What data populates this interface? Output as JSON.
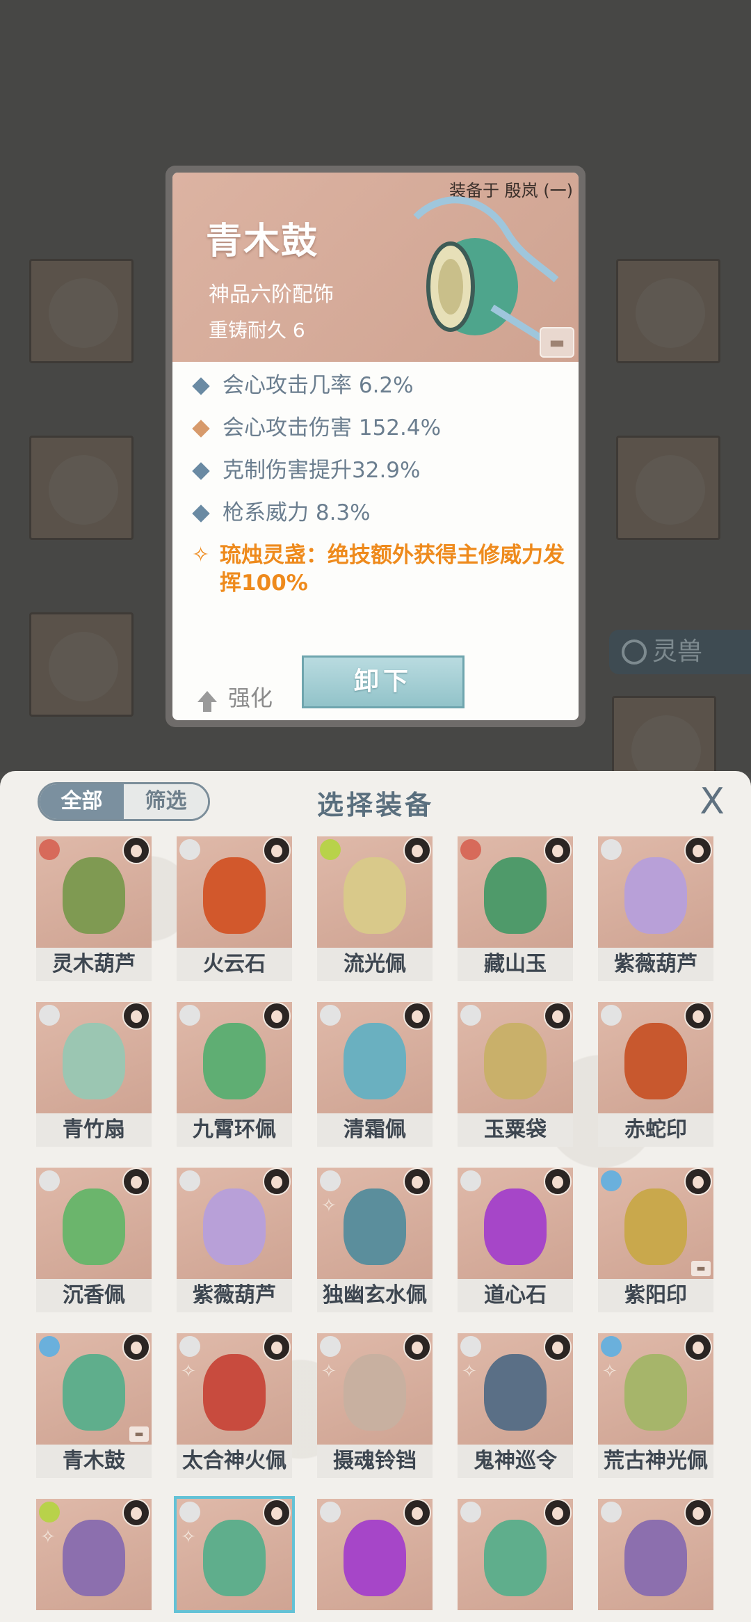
{
  "background": {
    "tab_label": "灵兽"
  },
  "detail": {
    "equipped_on": "装备于 殷岚 (一)",
    "name": "青木鼓",
    "grade": "神品六阶配饰",
    "durability": "重铸耐久 6",
    "stats": [
      {
        "text": "会心攻击几率 6.2%",
        "color": "#6a8aa3"
      },
      {
        "text": "会心攻击伤害 152.4%",
        "color": "#d79a6b"
      },
      {
        "text": "克制伤害提升32.9%",
        "color": "#6a8aa3"
      },
      {
        "text": "枪系威力 8.3%",
        "color": "#6a8aa3"
      }
    ],
    "special": "琉烛灵盏：绝技额外获得主修威力发挥100%",
    "upgrade_label": "强化",
    "unequip_label": "卸下"
  },
  "panel": {
    "tab_all": "全部",
    "tab_filter": "筛选",
    "title": "选择装备",
    "close": "X"
  },
  "items": [
    {
      "name": "灵木葫芦",
      "type_color": "#d76a5a",
      "art": "#7f9a52"
    },
    {
      "name": "火云石",
      "type_color": "#e3e3e3",
      "art": "#d2582c"
    },
    {
      "name": "流光佩",
      "type_color": "#b8d24a",
      "art": "#d9c98a"
    },
    {
      "name": "藏山玉",
      "type_color": "#d76a5a",
      "art": "#4f9a6a"
    },
    {
      "name": "紫薇葫芦",
      "type_color": "#e3e3e3",
      "art": "#b8a0d8"
    },
    {
      "name": "青竹扇",
      "type_color": "#e3e3e3",
      "art": "#9bc6b2"
    },
    {
      "name": "九霄环佩",
      "type_color": "#e3e3e3",
      "art": "#5fae73"
    },
    {
      "name": "清霜佩",
      "type_color": "#e3e3e3",
      "art": "#6ab0c0"
    },
    {
      "name": "玉粟袋",
      "type_color": "#e3e3e3",
      "art": "#c9b06a"
    },
    {
      "name": "赤蛇印",
      "type_color": "#e3e3e3",
      "art": "#c8582e"
    },
    {
      "name": "沉香佩",
      "type_color": "#e3e3e3",
      "art": "#6bb56c"
    },
    {
      "name": "紫薇葫芦",
      "type_color": "#e3e3e3",
      "art": "#b8a0d8"
    },
    {
      "name": "独幽玄水佩",
      "type_color": "#e3e3e3",
      "art": "#5b8e9c"
    },
    {
      "name": "道心石",
      "type_color": "#e3e3e3",
      "art": "#a646c8"
    },
    {
      "name": "紫阳印",
      "type_color": "#6ab0dc",
      "art": "#c9a84c"
    },
    {
      "name": "青木鼓",
      "type_color": "#6ab0dc",
      "art": "#5fae8c"
    },
    {
      "name": "太合神火佩",
      "type_color": "#e3e3e3",
      "art": "#c84b3e"
    },
    {
      "name": "摄魂铃铛",
      "type_color": "#e3e3e3",
      "art": "#c8b0a0"
    },
    {
      "name": "鬼神巡令",
      "type_color": "#e3e3e3",
      "art": "#5a6f86"
    },
    {
      "name": "荒古神光佩",
      "type_color": "#6ab0dc",
      "art": "#a6b56a"
    },
    {
      "name": "",
      "type_color": "#b8d24a",
      "art": "#8c6fae"
    },
    {
      "name": "",
      "type_color": "#e3e3e3",
      "art": "#5fae8c"
    },
    {
      "name": "",
      "type_color": "#e3e3e3",
      "art": "#a646c8"
    },
    {
      "name": "",
      "type_color": "#e3e3e3",
      "art": "#5fae8c"
    },
    {
      "name": "",
      "type_color": "#e3e3e3",
      "art": "#8c6fae"
    }
  ]
}
